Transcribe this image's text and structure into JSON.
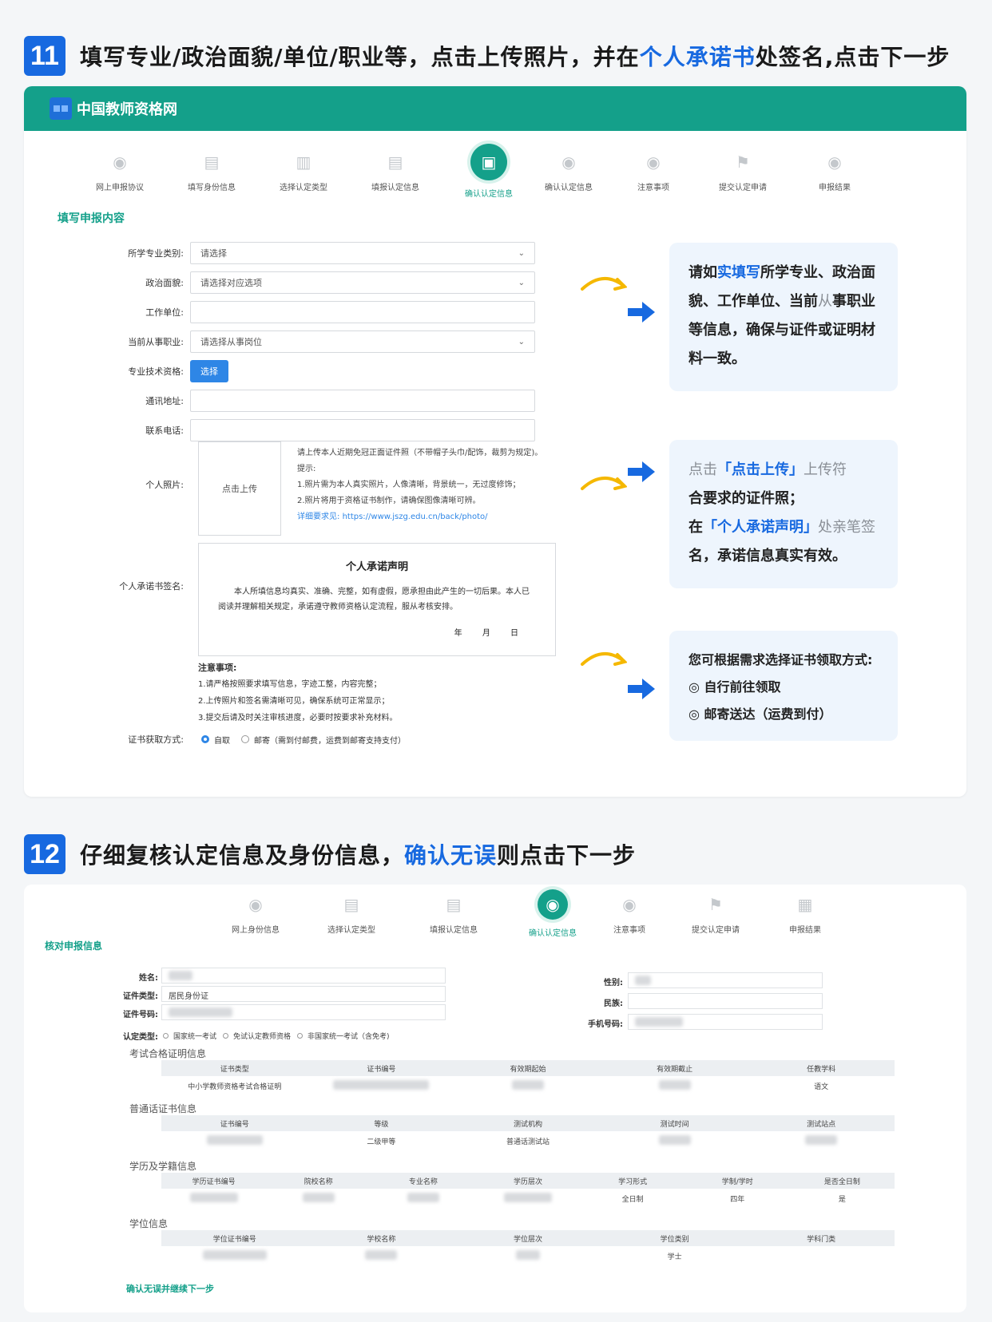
{
  "step11": {
    "num": "11",
    "text_pre": "填写专业/政治面貌/单位/职业等，点击上传照片，并在",
    "text_hl": "个人承诺书",
    "text_post": "处签名,点击下一步"
  },
  "panel1": {
    "site_title": "中国教师资格网",
    "steps": [
      {
        "label": "网上申报协议",
        "icon": "eye-icon"
      },
      {
        "label": "填写身份信息",
        "icon": "form-icon"
      },
      {
        "label": "选择认定类型",
        "icon": "building-icon"
      },
      {
        "label": "填报认定信息",
        "icon": "form-icon"
      },
      {
        "label": "确认认定信息",
        "icon": "doc-icon"
      },
      {
        "label": "确认认定信息",
        "icon": "eye-icon"
      },
      {
        "label": "注意事项",
        "icon": "eye-icon"
      },
      {
        "label": "提交认定申请",
        "icon": "flag-icon"
      },
      {
        "label": "申报结果",
        "icon": "eye-icon"
      }
    ],
    "section_title": "填写申报内容",
    "fields": {
      "major_label": "所学专业类别:",
      "major_value": "请选择",
      "politics_label": "政治面貌:",
      "politics_value": "请选择对应选项",
      "work_label": "工作单位:",
      "job_label": "当前从事职业:",
      "job_value": "请选择从事岗位",
      "tech_label": "专业技术资格:",
      "tech_button": "选择",
      "address_label": "通讯地址:",
      "phone_label": "联系电话:",
      "photo_label": "个人照片:",
      "upload_label": "点击上传",
      "pledge_label": "个人承诺书签名:",
      "cert_method_label": "证书获取方式:"
    },
    "photo_tips": {
      "line1": "请上传本人近期免冠正面证件照（不带帽子头巾/配饰，裁剪为规定)。",
      "line2": "提示:",
      "line3": "1.照片需为本人真实照片，人像清晰，背景统一，无过度修饰；",
      "line4": "2.照片将用于资格证书制作，请确保图像清晰可辨。",
      "link_label": "详细要求见:",
      "link": "https://www.jszg.edu.cn/back/photo/"
    },
    "pledge": {
      "title": "个人承诺声明",
      "body": "本人所填信息均真实、准确、完整，如有虚假，愿承担由此产生的一切后果。本人已阅读并理解相关规定，承诺遵守教师资格认定流程，服从考核安排。",
      "date": "年 月 日"
    },
    "notes": {
      "title": "注意事项:",
      "n1": "1.请严格按照要求填写信息，字迹工整，内容完整；",
      "n2": "2.上传照片和签名需清晰可见，确保系统可正常显示；",
      "n3": "3.提交后请及时关注审核进度，必要时按要求补充材料。"
    },
    "cert_options": {
      "self": "自取",
      "mail": "邮寄（需到付邮费，运费到邮寄支持支付）"
    }
  },
  "callouts": {
    "c1": {
      "p1": "请如",
      "hl": "实填写",
      "p2": "所学专业、政治面貌、工作单位、当前",
      "gray": "从",
      "p3": "事职业等信息，确保与证件或证明材料一致。"
    },
    "c2": {
      "g1": "点击",
      "hl1": "「点击上传」",
      "g2": "上传符",
      "p1": "合要求的证件照；",
      "p2": "在",
      "hl2": "「个人承诺声明」",
      "g3": "处亲笔签",
      "p3": "名，承诺信息真实有效。"
    },
    "c3": {
      "title": "您可根据需求选择证书领取方式:",
      "opt1": "自行前往领取",
      "opt2": "邮寄送达（运费到付）"
    }
  },
  "step12": {
    "num": "12",
    "text_pre": "仔细复核认定信息及身份信息，",
    "text_hl": "确认无误",
    "text_post": "则点击下一步"
  },
  "panel2": {
    "steps": [
      "网上身份信息",
      "选择认定类型",
      "填报认定信息",
      "确认认定信息",
      "注意事项",
      "提交认定申请",
      "申报结果"
    ],
    "section_title": "核对申报信息",
    "name_label": "姓名:",
    "id_type_label": "证件类型:",
    "id_type_value": "居民身份证",
    "id_no_label": "证件号码:",
    "gender_label": "性别:",
    "ethnic_label": "民族:",
    "mobile_label": "手机号码:",
    "type_label": "认定类型:",
    "type_opts": [
      "国家统一考试",
      "免试认定教师资格",
      "非国家统一考试（含免考)"
    ],
    "exam_title": "考试合格证明信息",
    "exam_cols": [
      "证书类型",
      "证书编号",
      "有效期起始",
      "有效期截止",
      "任教学科"
    ],
    "exam_row": [
      "中小学教师资格考试合格证明",
      "",
      "",
      "",
      "语文"
    ],
    "pth_title": "普通话证书信息",
    "pth_cols": [
      "证书编号",
      "等级",
      "测试机构",
      "测试时间",
      "测试站点"
    ],
    "pth_row": [
      "",
      "二级甲等",
      "普通话测试站",
      "",
      ""
    ],
    "edu_title": "学历及学籍信息",
    "edu_cols": [
      "学历证书编号",
      "院校名称",
      "专业名称",
      "学历层次",
      "学习形式",
      "学制/学时",
      "是否全日制"
    ],
    "edu_row": [
      "",
      "",
      "",
      "",
      "全日制",
      "四年",
      "是"
    ],
    "deg_title": "学位信息",
    "deg_cols": [
      "学位证书编号",
      "学校名称",
      "学位层次",
      "学位类别",
      "学科门类"
    ],
    "deg_row": [
      "",
      "",
      "",
      "学士",
      ""
    ],
    "confirm": "确认无误并继续下一步"
  }
}
